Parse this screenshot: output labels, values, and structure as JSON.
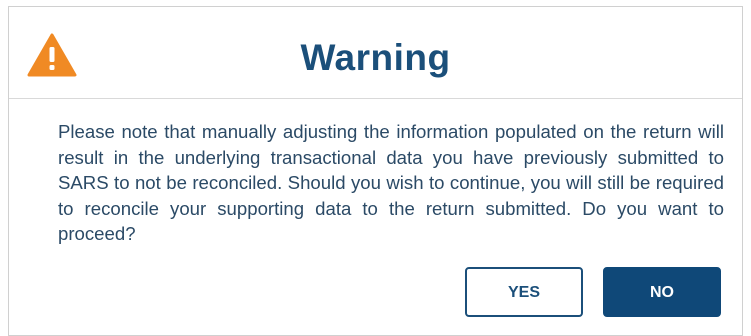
{
  "dialog": {
    "title": "Warning",
    "icon": "warning-triangle-icon",
    "message": "Please note that manually adjusting the information populated on the return will result in the underlying transactional data you have previously submitted to SARS to not be reconciled. Should you wish to continue, you will still be required to reconcile your supporting data to the return submitted. Do you want to proceed?",
    "yes_label": "YES",
    "no_label": "NO"
  },
  "colors": {
    "title": "#1b4f7a",
    "warning_icon": "#f08a24",
    "primary_button": "#0f4878",
    "message_text": "#2b4a66"
  }
}
